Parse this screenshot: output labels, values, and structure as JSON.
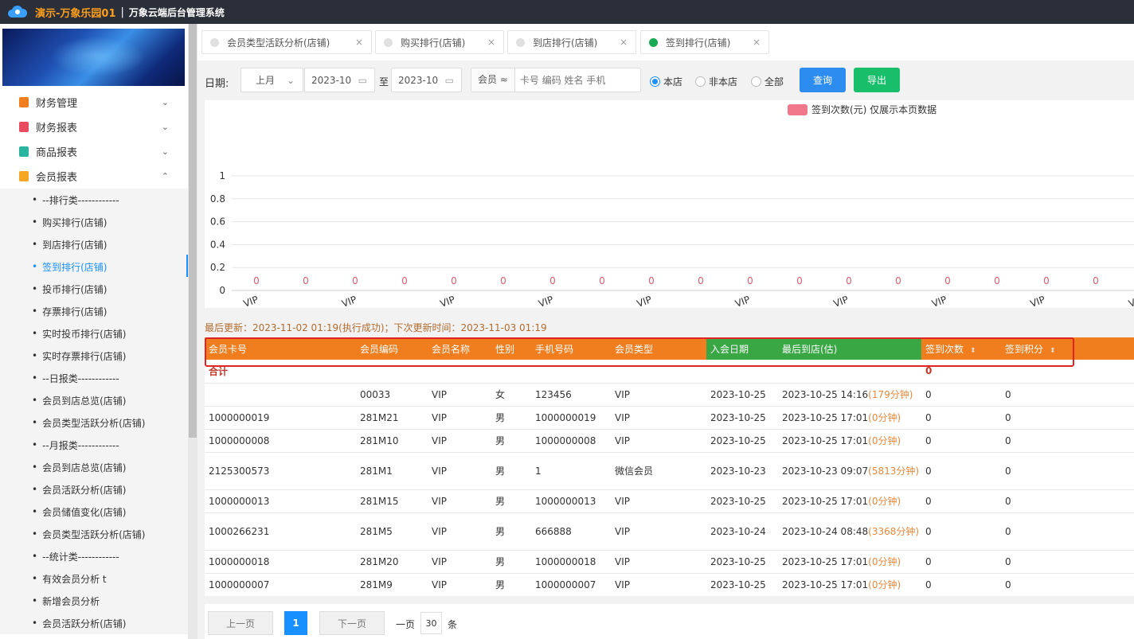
{
  "header": {
    "brand": "演示-万象乐园01",
    "separator": "|",
    "system": "万象云端后台管理系统"
  },
  "sidebar": {
    "groups": [
      {
        "label": "财务管理",
        "icon": "ledger-icon",
        "color": "#f07d1e",
        "chevron": "⌄"
      },
      {
        "label": "财务报表",
        "icon": "report-icon",
        "color": "#e84a5f",
        "chevron": "⌄"
      },
      {
        "label": "商品报表",
        "icon": "goods-icon",
        "color": "#2bb5a0",
        "chevron": "⌄"
      },
      {
        "label": "会员报表",
        "icon": "member-icon",
        "color": "#f5a623",
        "chevron": "⌃"
      }
    ],
    "items": [
      "--排行类------------",
      "购买排行(店铺)",
      "到店排行(店铺)",
      "签到排行(店铺)",
      "投币排行(店铺)",
      "存票排行(店铺)",
      "实时投币排行(店铺)",
      "实时存票排行(店铺)",
      "--日报类------------",
      "会员到店总览(店铺)",
      "会员类型活跃分析(店铺)",
      "--月报类------------",
      "会员到店总览(店铺)",
      "会员活跃分析(店铺)",
      "会员储值变化(店铺)",
      "会员类型活跃分析(店铺)",
      "--统计类------------",
      "有效会员分析 t",
      "新增会员分析",
      "会员活跃分析(店铺)"
    ],
    "active_item": "签到排行(店铺)"
  },
  "tabs": [
    {
      "label": "会员类型活跃分析(店铺)",
      "close": "×"
    },
    {
      "label": "购买排行(店铺)",
      "close": "×"
    },
    {
      "label": "到店排行(店铺)",
      "close": "×"
    },
    {
      "label": "签到排行(店铺)",
      "close": "×",
      "active": true
    }
  ],
  "filter": {
    "date_label": "日期:",
    "period": "上月",
    "start": "2023-10",
    "to": "至",
    "end": "2023-10",
    "member_prefix": "会员 ≈",
    "member_placeholder": "卡号 编码 姓名 手机",
    "radios": [
      "本店",
      "非本店",
      "全部"
    ],
    "selected_radio": "本店",
    "query": "查询",
    "export": "导出",
    "query_color": "#2d8cf0",
    "export_color": "#19be6b"
  },
  "chart_data": {
    "type": "bar",
    "legend": "签到次数(元) 仅展示本页数据",
    "legend_color": "#f0788a",
    "y_ticks": [
      "1",
      "0.8",
      "0.6",
      "0.4",
      "0.2",
      "0"
    ],
    "ylim": [
      0,
      1
    ],
    "categories": [
      "VIP",
      "VIP",
      "VIP",
      "VIP",
      "VIP",
      "VIP",
      "VIP",
      "VIP",
      "VIP",
      "VIP"
    ],
    "values": [
      0,
      0,
      0,
      0,
      0,
      0,
      0,
      0,
      0,
      0,
      0,
      0,
      0,
      0,
      0,
      0,
      0,
      0,
      0,
      0
    ],
    "value_labels": [
      "0",
      "0",
      "0",
      "0",
      "0",
      "0",
      "0",
      "0",
      "0",
      "0",
      "0",
      "0",
      "0",
      "0",
      "0",
      "0",
      "0",
      "0"
    ]
  },
  "last_update": "最后更新：2023-11-02 01:19(执行成功)；下次更新时间：2023-11-03 01:19",
  "table": {
    "columns": [
      "会员卡号",
      "会员编码",
      "会员名称",
      "性别",
      "手机号码",
      "会员类型",
      "入会日期",
      "最后到店(估)",
      "签到次数",
      "签到积分"
    ],
    "sort_icon": "⬍",
    "total_label": "合计",
    "total_count": "0",
    "rows": [
      {
        "card": "",
        "code": "00033",
        "name": "VIP",
        "sex": "女",
        "phone": "123456",
        "type": "VIP",
        "join": "2023-10-25",
        "last": "2023-10-25 14:16",
        "mins": "(179分钟)",
        "count": "0",
        "points": "0"
      },
      {
        "card": "1000000019",
        "code": "281M21",
        "name": "VIP",
        "sex": "男",
        "phone": "1000000019",
        "type": "VIP",
        "join": "2023-10-25",
        "last": "2023-10-25 17:01",
        "mins": "(0分钟)",
        "count": "0",
        "points": "0"
      },
      {
        "card": "1000000008",
        "code": "281M10",
        "name": "VIP",
        "sex": "男",
        "phone": "1000000008",
        "type": "VIP",
        "join": "2023-10-25",
        "last": "2023-10-25 17:01",
        "mins": "(0分钟)",
        "count": "0",
        "points": "0"
      },
      {
        "card": "2125300573",
        "code": "281M1",
        "name": "VIP",
        "sex": "男",
        "phone": "1",
        "type": "微信会员",
        "join": "2023-10-23",
        "last": "2023-10-23 09:07",
        "mins": "(5813分钟)",
        "count": "0",
        "points": "0",
        "tall": true
      },
      {
        "card": "1000000013",
        "code": "281M15",
        "name": "VIP",
        "sex": "男",
        "phone": "1000000013",
        "type": "VIP",
        "join": "2023-10-25",
        "last": "2023-10-25 17:01",
        "mins": "(0分钟)",
        "count": "0",
        "points": "0"
      },
      {
        "card": "1000266231",
        "code": "281M5",
        "name": "VIP",
        "sex": "男",
        "phone": "666888",
        "type": "VIP",
        "join": "2023-10-24",
        "last": "2023-10-24 08:48",
        "mins": "(3368分钟)",
        "count": "0",
        "points": "0",
        "tall": true
      },
      {
        "card": "1000000018",
        "code": "281M20",
        "name": "VIP",
        "sex": "男",
        "phone": "1000000018",
        "type": "VIP",
        "join": "2023-10-25",
        "last": "2023-10-25 17:01",
        "mins": "(0分钟)",
        "count": "0",
        "points": "0"
      },
      {
        "card": "1000000007",
        "code": "281M9",
        "name": "VIP",
        "sex": "男",
        "phone": "1000000007",
        "type": "VIP",
        "join": "2023-10-25",
        "last": "2023-10-25 17:01",
        "mins": "(0分钟)",
        "count": "0",
        "points": "0"
      }
    ]
  },
  "pager": {
    "prev": "上一页",
    "current": "1",
    "next": "下一页",
    "per_page_label": "一页",
    "page_size": "30",
    "unit": "条"
  }
}
